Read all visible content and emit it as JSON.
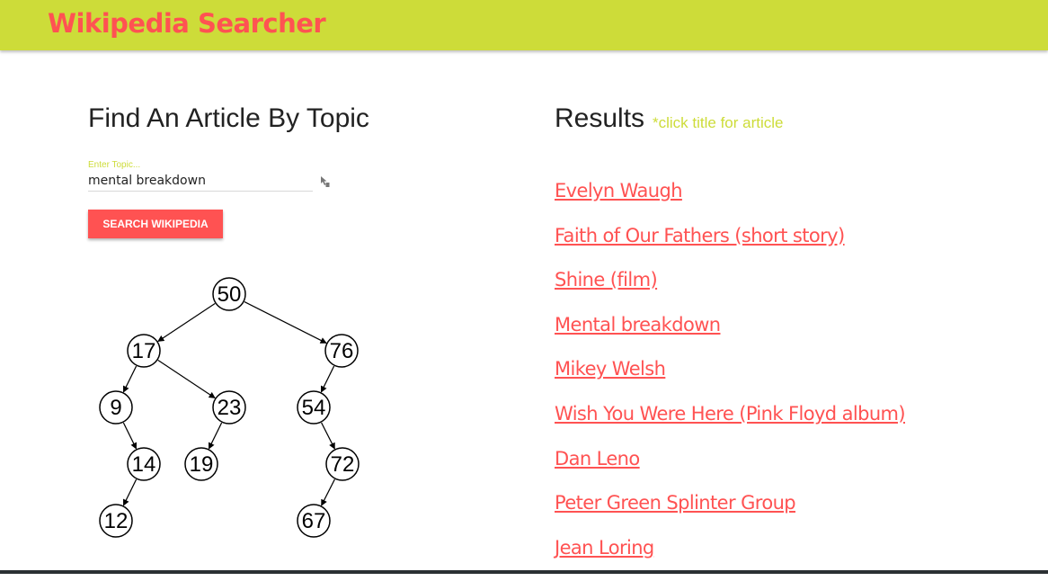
{
  "header": {
    "brand": "Wikipedia Searcher"
  },
  "search": {
    "title": "Find An Article By Topic",
    "label": "Enter Topic...",
    "value": "mental breakdown",
    "button_label": "SEARCH WIKIPEDIA"
  },
  "tree": {
    "nodes": [
      {
        "id": "50",
        "label": "50"
      },
      {
        "id": "17",
        "label": "17"
      },
      {
        "id": "76",
        "label": "76"
      },
      {
        "id": "9",
        "label": "9"
      },
      {
        "id": "23",
        "label": "23"
      },
      {
        "id": "54",
        "label": "54"
      },
      {
        "id": "14",
        "label": "14"
      },
      {
        "id": "19",
        "label": "19"
      },
      {
        "id": "72",
        "label": "72"
      },
      {
        "id": "12",
        "label": "12"
      },
      {
        "id": "67",
        "label": "67"
      }
    ],
    "edges": [
      [
        "50",
        "17"
      ],
      [
        "50",
        "76"
      ],
      [
        "17",
        "9"
      ],
      [
        "17",
        "23"
      ],
      [
        "76",
        "54"
      ],
      [
        "9",
        "14"
      ],
      [
        "23",
        "19"
      ],
      [
        "54",
        "72"
      ],
      [
        "14",
        "12"
      ],
      [
        "72",
        "67"
      ]
    ]
  },
  "results": {
    "heading": "Results",
    "hint": "*click title for article",
    "items": [
      "Evelyn Waugh",
      "Faith of Our Fathers (short story)",
      "Shine (film)",
      "Mental breakdown",
      "Mikey Welsh",
      "Wish You Were Here (Pink Floyd album)",
      "Dan Leno",
      "Peter Green Splinter Group",
      "Jean Loring"
    ]
  },
  "colors": {
    "accent": "#cddc39",
    "brand": "#ff5252"
  }
}
